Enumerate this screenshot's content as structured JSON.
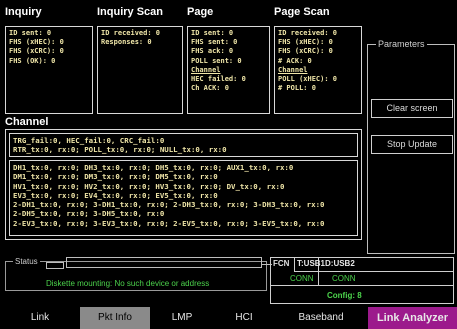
{
  "sections": {
    "inquiry": {
      "title": "Inquiry",
      "lines": [
        "ID sent: 0",
        "FHS (xHEC): 0",
        "FHS (xCRC): 0",
        "FHS (OK): 0"
      ]
    },
    "inquiry_scan": {
      "title": "Inquiry Scan",
      "lines": [
        "ID received: 0",
        "Responses: 0"
      ]
    },
    "page": {
      "title": "Page",
      "lines": [
        "ID sent: 0",
        "FHS sent: 0",
        "FHS ack: 0",
        "POLL sent: 0",
        "Channel",
        "HEC failed: 0",
        "Ch ACK: 0"
      ]
    },
    "page_scan": {
      "title": "Page Scan",
      "lines": [
        "ID received: 0",
        "FHS (xHEC): 0",
        "FHS (xCRC): 0",
        "# ACK: 0",
        "Channel",
        "POLL (xHEC): 0",
        "# POLL: 0"
      ]
    }
  },
  "parameters": {
    "title": "Parameters",
    "clear_label": "Clear screen",
    "stop_label": "Stop Update"
  },
  "channel": {
    "title": "Channel",
    "block1": [
      "TRG_fail:0, HEC_fail:0, CRC_fail:0",
      "RTR_tx:0, rx:0; POLL_tx:0, rx:0; NULL_tx:0, rx:0"
    ],
    "block2": [
      "DH1_tx:0, rx:0; DH3_tx:0, rx:0; DH5_tx:0, rx:0; AUX1_tx:0, rx:0",
      "DM1_tx:0, rx:0; DM3_tx:0, rx:0; DM5_tx:0, rx:0",
      "HV1_tx:0, rx:0; HV2_tx:0, rx:0; HV3_tx:0, rx:0; DV_tx:0, rx:0",
      "EV3_tx:0, rx:0; EV4_tx:0, rx:0; EV5_tx:0, rx:0",
      "2-DH1_tx:0, rx:0; 3-DH1_tx:0, rx:0; 2-DH3_tx:0, rx:0; 3-DH3_tx:0, rx:0",
      "2-DH5_tx:0, rx:0; 3-DH5_tx:0, rx:0",
      "2-EV3_tx:0, rx:0; 3-EV3_tx:0, rx:0; 2-EV5_tx:0, rx:0; 3-EV5_tx:0, rx:0"
    ]
  },
  "status": {
    "label": "Status",
    "message": "Diskette mounting: No such device or address",
    "fcn_label": "FCN",
    "usb1": "T:USB1",
    "usb2": "D:USB2",
    "conn1": "CONN",
    "conn2": "CONN",
    "config": "Config: 8"
  },
  "tabs": {
    "link": "Link",
    "pkt_info": "Pkt Info",
    "lmp": "LMP",
    "hci": "HCI",
    "baseband": "Baseband",
    "analyzer": "Link Analyzer"
  },
  "colors": {
    "text_yellow": "#f0e6a8",
    "green": "#4cd44c",
    "analyzer_bg": "#9c1a8c",
    "active_tab_bg": "#8a8a8a"
  }
}
